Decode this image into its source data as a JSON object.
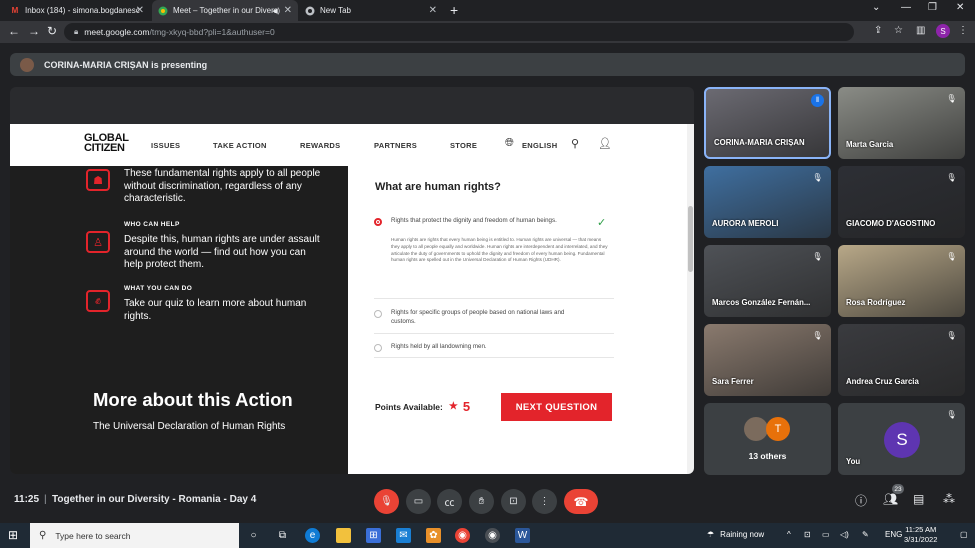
{
  "browser": {
    "tabs": [
      {
        "title": "Inbox (184) - simona.bogdanesc",
        "icon": "gmail-icon"
      },
      {
        "title": "Meet – Together in our Divers",
        "icon": "meet-icon"
      },
      {
        "title": "New Tab",
        "icon": "chrome-icon"
      }
    ],
    "new_tab_label": "+",
    "url_host": "meet.google.com",
    "url_path": "/tmg-xkyq-bbd?pli=1&authuser=0",
    "profile_initial": "S"
  },
  "meet": {
    "presenting_text": "CORINA-MARIA CRIȘAN is presenting",
    "clock": "11:25",
    "meeting_name": "Together in our Diversity - Romania - Day 4",
    "participants_count": "23",
    "tiles": [
      {
        "name": "CORINA-MARIA CRIȘAN",
        "color": "#6b6a72"
      },
      {
        "name": "Marta Garcia",
        "color": "#8a8c86"
      },
      {
        "name": "AURORA MEROLI",
        "color": "#3f6fa0"
      },
      {
        "name": "GIACOMO D'AGOSTINO",
        "color": "#2d2f35"
      },
      {
        "name": "Marcos González Fernán...",
        "color": "#4f5257"
      },
      {
        "name": "Rosa Rodríguez",
        "color": "#b8a888"
      },
      {
        "name": "Sara Ferrer",
        "color": "#8a7a6e"
      },
      {
        "name": "Andrea Cruz Garcia",
        "color": "#3a3b3f"
      }
    ],
    "others_label": "13 others",
    "others_initial": "T",
    "you_label": "You",
    "you_initial": "S"
  },
  "site": {
    "logo_line1": "GLOBAL",
    "logo_line2": "CITIZEN",
    "nav": [
      "ISSUES",
      "TAKE ACTION",
      "REWARDS",
      "PARTNERS",
      "STORE"
    ],
    "language": "ENGLISH",
    "info_blocks": [
      {
        "heading": "",
        "body": "These fundamental rights apply to all people without discrimination, regardless of any characteristic."
      },
      {
        "heading": "WHO CAN HELP",
        "body": "Despite this, human rights are under assault around the world — find out how you can help protect them."
      },
      {
        "heading": "WHAT YOU CAN DO",
        "body": "Take our quiz to learn more about human rights."
      }
    ],
    "more_title": "More about this Action",
    "more_sub": "The Universal Declaration of Human Rights",
    "quiz": {
      "question": "What are human rights?",
      "options": [
        "Rights that protect the dignity and freedom of human beings.",
        "Rights for specific groups of people based on national laws and customs.",
        "Rights held by all landowning men."
      ],
      "explanation": "Human rights are rights that every human being is entitled to. Human rights are universal — that means they apply to all people equally and worldwide. Human rights are interdependent and interrelated, and they articulate the duty of governments to uphold the dignity and freedom of every human being. Fundamental human rights are spelled out in the Universal Declaration of Human Rights (UDHR).",
      "points_label": "Points Available:",
      "points_value": "5",
      "next_label": "NEXT QUESTION"
    }
  },
  "taskbar": {
    "search_placeholder": "Type here to search",
    "weather": "Raining now",
    "lang": "ENG",
    "time": "11:25 AM",
    "date": "3/31/2022"
  },
  "colors": {
    "accent_red": "#e3242b",
    "meet_red": "#ea4335",
    "meet_blue": "#1a73e8"
  }
}
